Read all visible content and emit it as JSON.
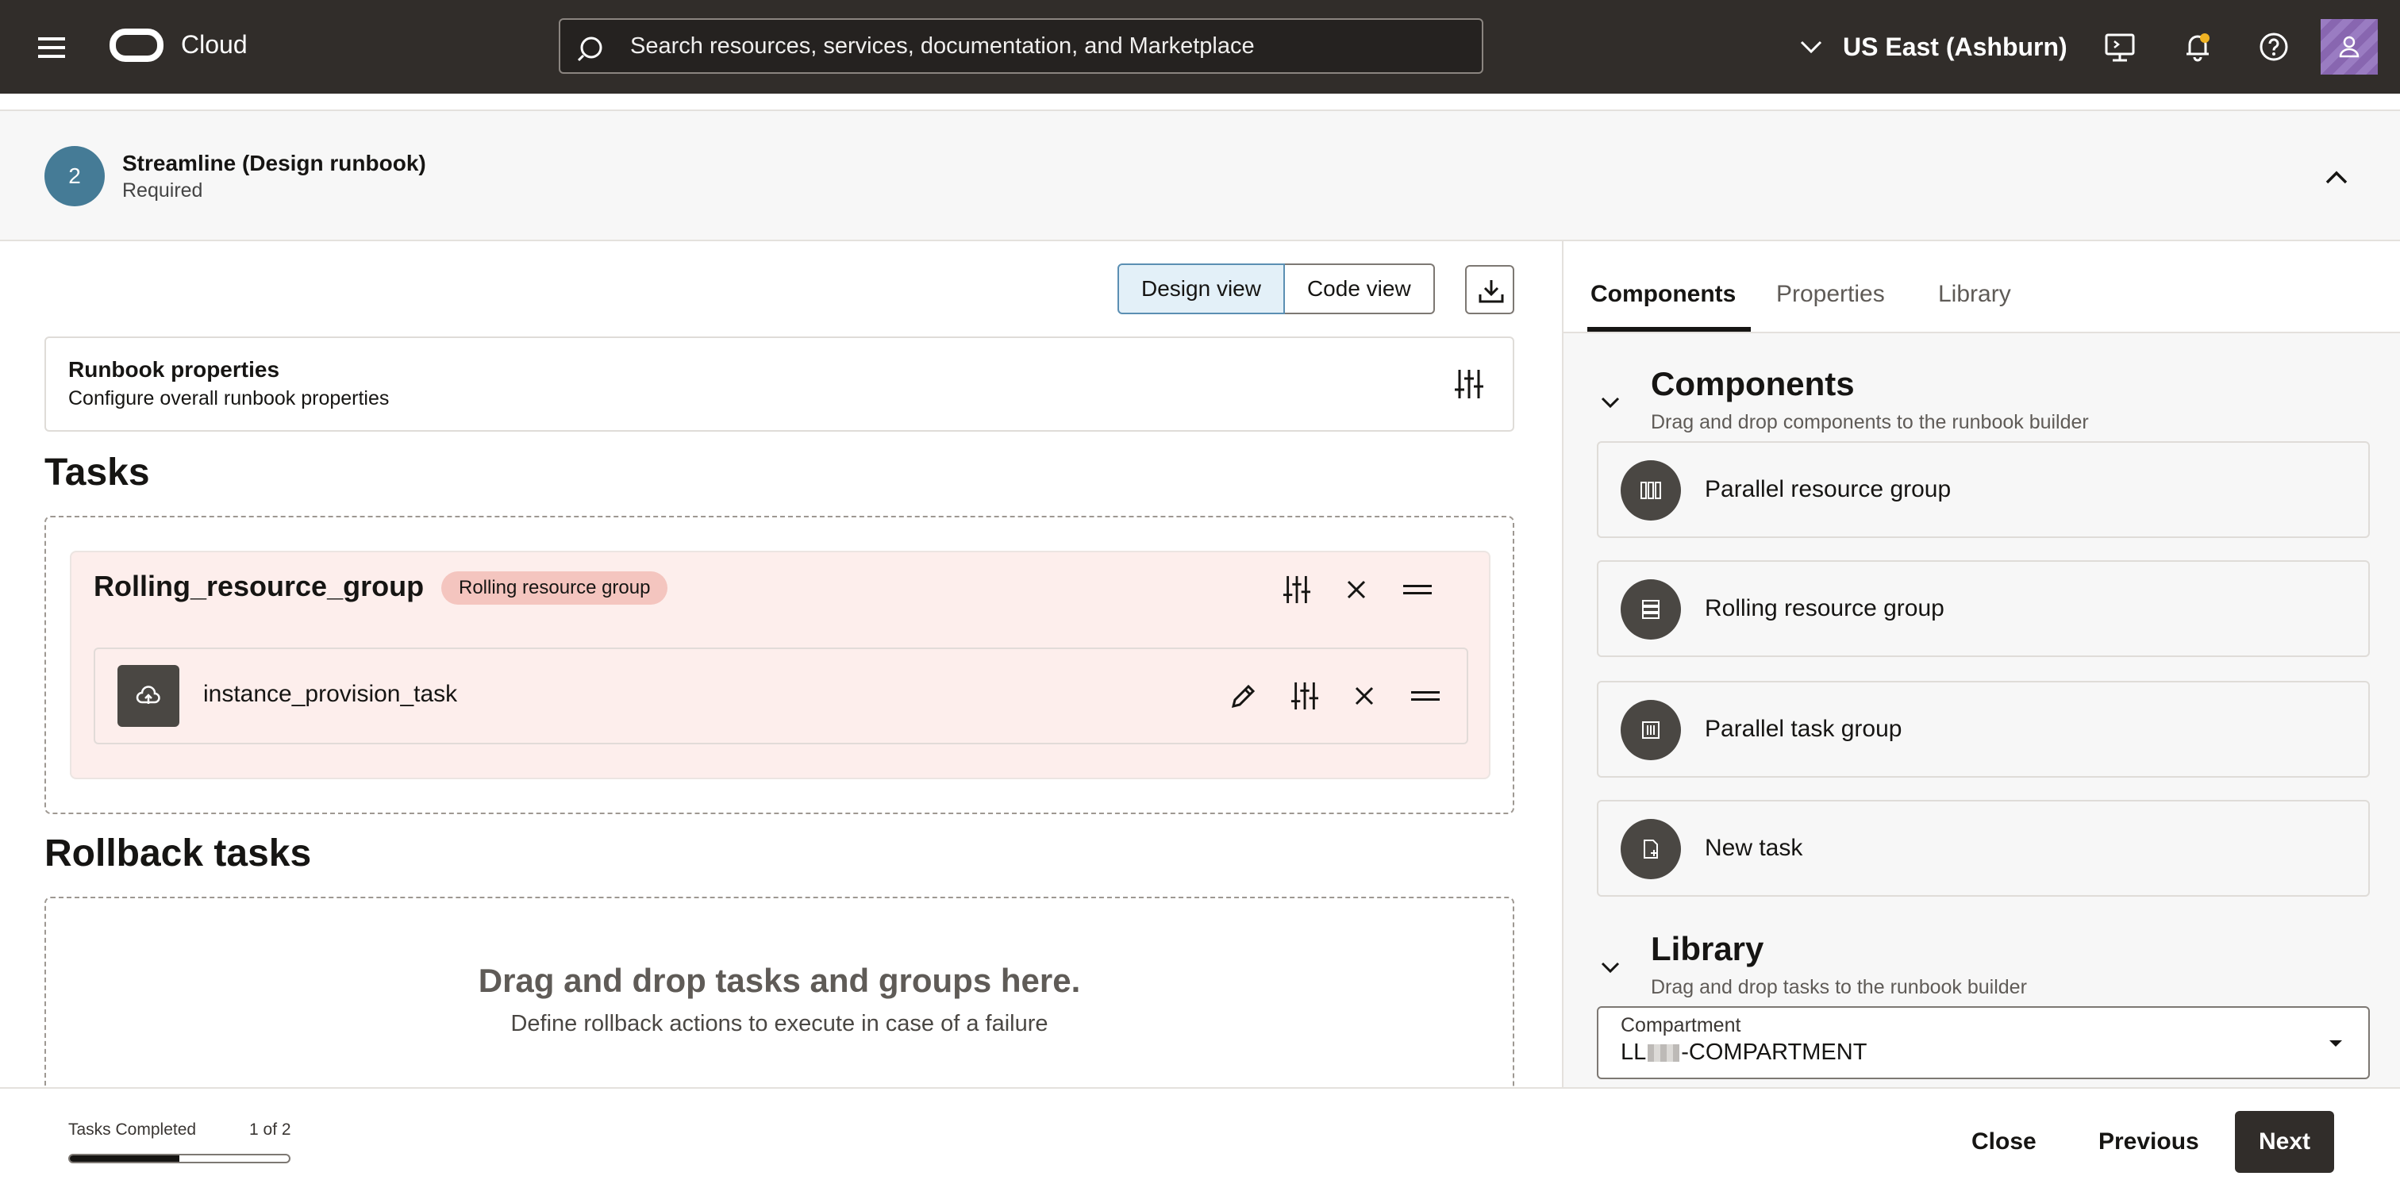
{
  "topbar": {
    "brand": "Cloud",
    "search_placeholder": "Search resources, services, documentation, and Marketplace",
    "region": "US East (Ashburn)"
  },
  "step": {
    "number": "2",
    "title": "Streamline (Design runbook)",
    "subtitle": "Required"
  },
  "main": {
    "design_view": "Design view",
    "code_view": "Code view",
    "runbook_properties": {
      "title": "Runbook properties",
      "subtitle": "Configure overall runbook properties"
    },
    "tasks_heading": "Tasks",
    "group": {
      "name": "Rolling_resource_group",
      "badge": "Rolling resource group",
      "task": "instance_provision_task"
    },
    "rollback_heading": "Rollback tasks",
    "rollback_drop_title": "Drag and drop tasks and groups here.",
    "rollback_drop_subtitle": "Define rollback actions to execute in case of a failure"
  },
  "panel": {
    "tabs": [
      "Components",
      "Properties",
      "Library"
    ],
    "components": {
      "heading": "Components",
      "subtitle": "Drag and drop components to the runbook builder",
      "items": [
        {
          "label": "Parallel resource group",
          "icon": "parallel-resource-group-icon"
        },
        {
          "label": "Rolling resource group",
          "icon": "rolling-resource-group-icon"
        },
        {
          "label": "Parallel task group",
          "icon": "parallel-task-group-icon"
        },
        {
          "label": "New task",
          "icon": "new-task-icon"
        }
      ]
    },
    "library": {
      "heading": "Library",
      "subtitle": "Drag and drop tasks to the runbook builder",
      "compartment_label": "Compartment",
      "compartment_prefix": "LL",
      "compartment_suffix": "-COMPARTMENT"
    }
  },
  "footer": {
    "progress_label": "Tasks Completed",
    "progress_count": "1 of 2",
    "progress_fraction": 0.5,
    "close": "Close",
    "previous": "Previous",
    "next": "Next"
  },
  "colors": {
    "topbar": "#312d2a",
    "step_circle": "#457b96",
    "group_background": "#fdeeec",
    "badge": "#f4c5bf"
  }
}
